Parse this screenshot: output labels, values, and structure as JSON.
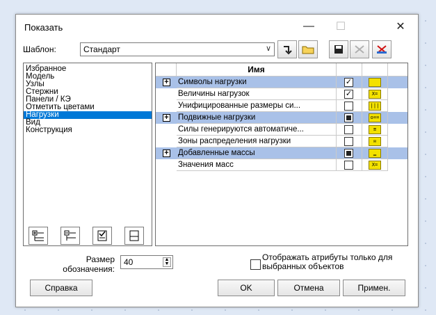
{
  "window": {
    "title": "Показать"
  },
  "template": {
    "label": "Шаблон:",
    "value": "Стандарт"
  },
  "categories": [
    {
      "label": "Избранное"
    },
    {
      "label": "Модель"
    },
    {
      "label": "Узлы"
    },
    {
      "label": "Стержни"
    },
    {
      "label": "Панели / КЭ"
    },
    {
      "label": "Отметить цветами"
    },
    {
      "label": "Нагрузки",
      "selected": true
    },
    {
      "label": "Вид"
    },
    {
      "label": "Конструкция"
    }
  ],
  "grid": {
    "header": "Имя",
    "rows": [
      {
        "label": "Символы нагрузки",
        "group": true,
        "state": "checked",
        "icon": "load-symbols-icon"
      },
      {
        "label": "Величины нагрузок",
        "group": false,
        "state": "checked",
        "icon": "load-values-icon"
      },
      {
        "label": "Унифицированные размеры си...",
        "group": false,
        "state": "unchecked",
        "icon": "unified-sizes-icon"
      },
      {
        "label": "Подвижные нагрузки",
        "group": true,
        "state": "indeterminate",
        "icon": "moving-loads-icon"
      },
      {
        "label": "Силы генерируются автоматиче...",
        "group": false,
        "state": "unchecked",
        "icon": "generated-forces-icon"
      },
      {
        "label": "Зоны распределения нагрузки",
        "group": false,
        "state": "unchecked",
        "icon": "distribution-zones-icon"
      },
      {
        "label": "Добавленные массы",
        "group": true,
        "state": "indeterminate",
        "icon": "added-masses-icon"
      },
      {
        "label": "Значения масс",
        "group": false,
        "state": "unchecked",
        "icon": "mass-values-icon"
      }
    ]
  },
  "size": {
    "label": "Размер обозначения:",
    "value": "40"
  },
  "attributes_option": {
    "label": "Отображать атрибуты только для выбранных объектов",
    "checked": false
  },
  "buttons": {
    "help": "Справка",
    "ok": "OK",
    "cancel": "Отмена",
    "apply": "Примен."
  },
  "colors": {
    "selection": "#0078d7",
    "group_row": "#a9c1e8",
    "icon_fill": "#f3e100"
  }
}
